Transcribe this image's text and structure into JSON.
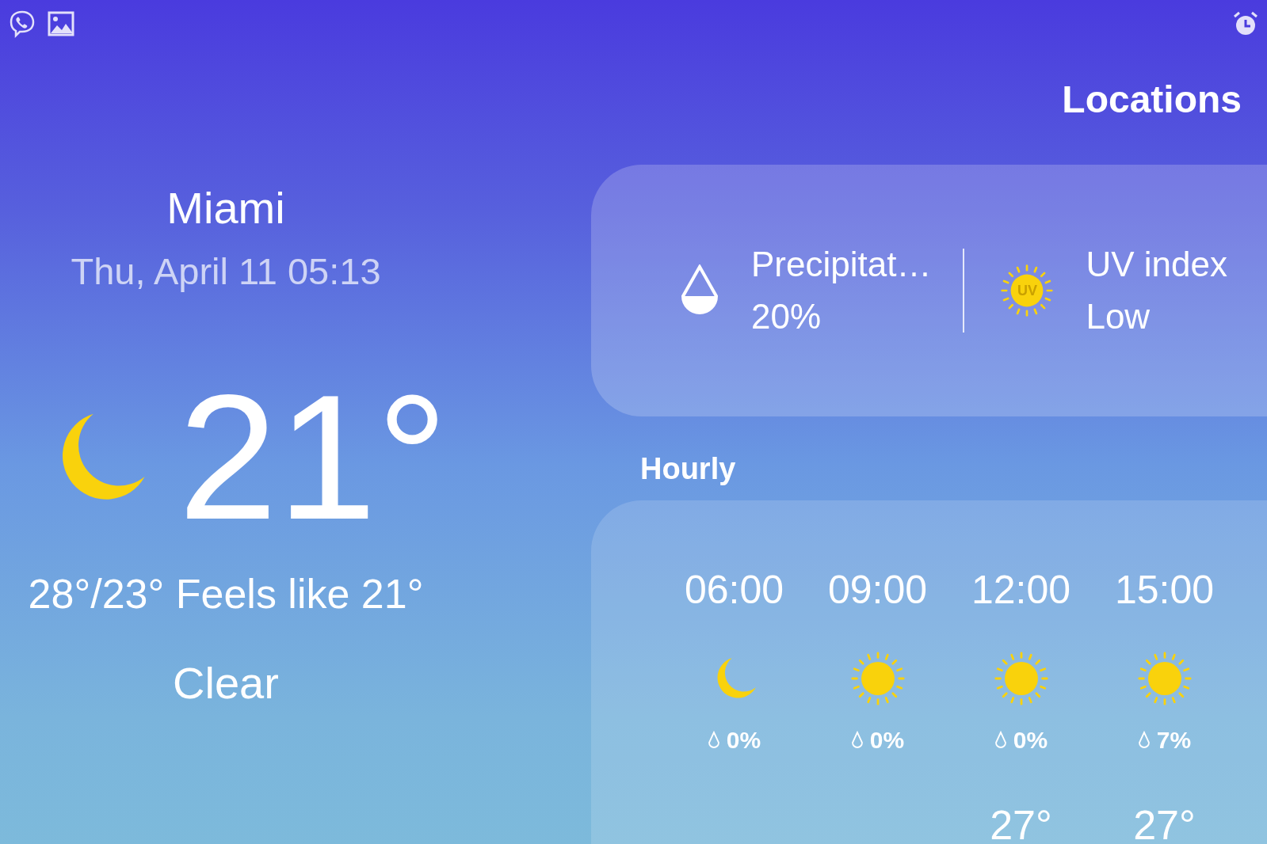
{
  "header": {
    "locations_button": "Locations"
  },
  "current": {
    "city": "Miami",
    "datetime": "Thu, April 11 05:13",
    "kind": "moon",
    "temperature": "21°",
    "range_feels": "28°/23° Feels like 21°",
    "condition": "Clear"
  },
  "details": [
    {
      "kind": "precipitation",
      "label": "Precipitat…",
      "value": "20%"
    },
    {
      "kind": "uv",
      "label": "UV index",
      "value": "Low",
      "badge": "UV"
    }
  ],
  "hourly": {
    "title": "Hourly",
    "items": [
      {
        "time": "06:00",
        "kind": "moon",
        "precip": "0%"
      },
      {
        "time": "09:00",
        "kind": "sun",
        "precip": "0%"
      },
      {
        "time": "12:00",
        "kind": "sun",
        "precip": "0%",
        "temp": "27°"
      },
      {
        "time": "15:00",
        "kind": "sun",
        "precip": "7%",
        "temp": "27°"
      }
    ]
  }
}
